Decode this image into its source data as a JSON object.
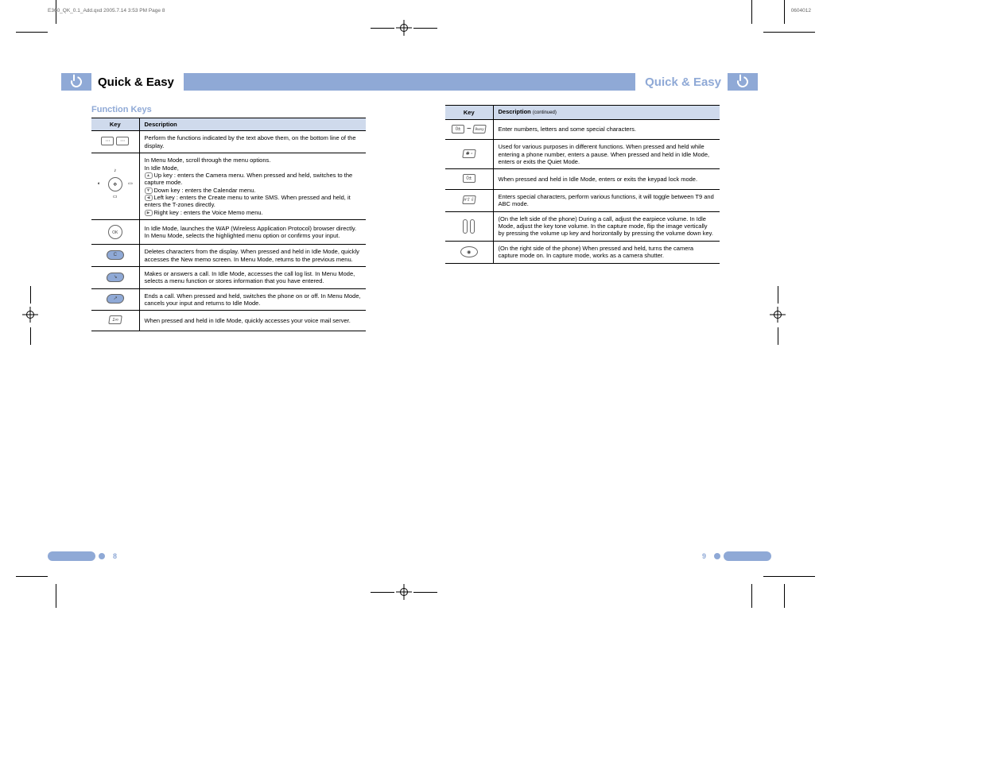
{
  "header": {
    "title_left": "Quick & Easy",
    "title_right": "Quick & Easy"
  },
  "left_page": {
    "section_title": "Function Keys",
    "table_header_key": "Key",
    "table_header_desc": "Description",
    "rows": [
      {
        "icon": "softkey-pair",
        "desc": "Perform the functions indicated by the text above them, on the bottom line of the display."
      },
      {
        "icon": "nav-cluster",
        "desc_lines": [
          "In Menu Mode, scroll through the menu options.",
          "In Idle Mode,",
          "Up key : enters the Camera menu. When pressed and held, switches to the capture mode.",
          "Down key : enters the Calendar menu.",
          "Left key : enters the Create menu to write SMS. When pressed and held, it enters the T-zones directly.",
          "Right key : enters the Voice Memo menu."
        ]
      },
      {
        "icon": "ok-key",
        "desc": "In Idle Mode, launches the WAP (Wireless Application Protocol) browser directly. In Menu Mode, selects the highlighted menu option or confirms your input."
      },
      {
        "icon": "c-key",
        "desc": "Deletes characters from the display. When pressed and held in Idle Mode, quickly accesses the New memo screen. In Menu Mode, returns to the previous menu."
      },
      {
        "icon": "call-key",
        "desc": "Makes or answers a call. In Idle Mode, accesses the call log list. In Menu Mode, selects a menu function or stores information that you have entered."
      },
      {
        "icon": "end-key",
        "desc": "Ends a call. When pressed and held, switches the phone on or off. In Menu Mode, cancels your input and returns to Idle Mode."
      },
      {
        "icon": "one-key",
        "desc": "When pressed and held in Idle Mode, quickly accesses your voice mail server."
      }
    ],
    "page_number": "8"
  },
  "right_page": {
    "rows": [
      {
        "icon": "zero-nine",
        "desc": "Enter numbers, letters and some special characters."
      },
      {
        "icon": "star-key",
        "desc": "Used for various purposes in different functions. When pressed and held while entering a phone number, enters a pause. When pressed and held in Idle Mode, enters or exits the Quiet Mode."
      },
      {
        "icon": "zero-key",
        "desc": "When pressed and held in Idle Mode, enters or exits the keypad lock mode."
      },
      {
        "icon": "hash-key",
        "desc": "Enters special characters, perform various functions, it will toggle between T9 and ABC mode."
      },
      {
        "icon": "volume-keys",
        "desc": "(On the left side of the phone) During a call, adjust the earpiece volume. In Idle Mode, adjust the key tone volume. In the capture mode, flip the image vertically by pressing the volume up key and horizontally by pressing the volume down key."
      },
      {
        "icon": "camera-key",
        "desc": "(On the right side of the phone) When pressed and held, turns the camera capture mode on. In capture mode, works as a camera shutter."
      }
    ],
    "page_number": "9"
  },
  "slug": {
    "left": "E360_QK_0.1_Add.qxd  2005.7.14  3:53 PM  Page 8",
    "right_partial": "0604012"
  }
}
